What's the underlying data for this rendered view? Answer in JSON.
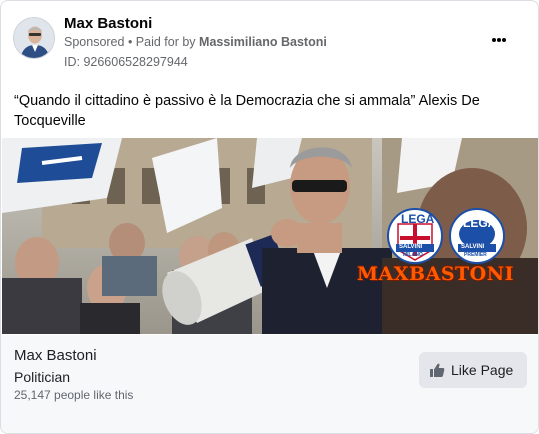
{
  "post": {
    "author": "Max Bastoni",
    "sponsored": "Sponsored",
    "paid_prefix": " • Paid for by ",
    "paid_by": "Massimiliano Bastoni",
    "ad_id": "ID: 926606528297944",
    "text": "“Quando il cittadino è passivo è la Democrazia che si ammala” Alexis De Tocqueville"
  },
  "image": {
    "brand_text": "MAXBASTONI",
    "badge_1": {
      "top": "LEGA",
      "ribbon": "SALVINI",
      "bottom": "MILANO"
    },
    "badge_2": {
      "top": "LEGA",
      "ribbon": "SALVINI",
      "bottom": "PREMIER"
    }
  },
  "page": {
    "name": "Max Bastoni",
    "category": "Politician",
    "likes": "25,147 people like this",
    "like_button": "Like Page"
  },
  "icons": {
    "more": "more-horizontal-icon",
    "like": "thumbs-up-icon"
  },
  "colors": {
    "brand_orange": "#ff5a00",
    "lega_blue": "#1c4fa8",
    "secondary_text": "#65676b"
  }
}
